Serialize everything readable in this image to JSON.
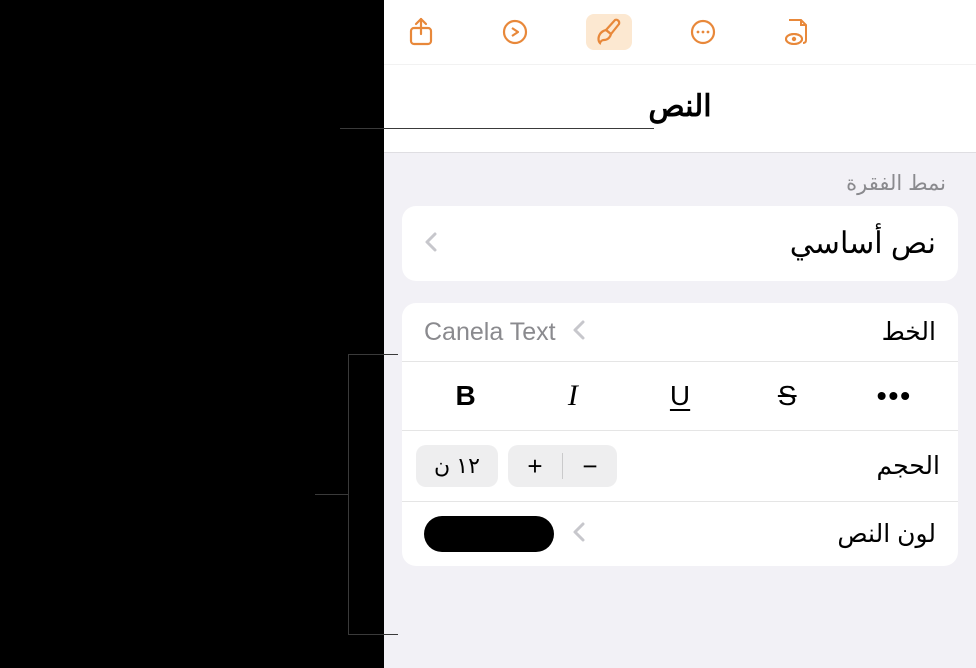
{
  "toolbar": {
    "accent": "#e8883a"
  },
  "panel": {
    "title": "النص",
    "paragraph_style_label": "نمط الفقرة",
    "paragraph_style_value": "نص أساسي",
    "font_label": "الخط",
    "font_value": "Canela Text",
    "styles": {
      "bold": "B",
      "italic": "I",
      "underline": "U",
      "strike": "S",
      "more": "•••"
    },
    "size_label": "الحجم",
    "size_value": "١٢ ن",
    "stepper_minus": "−",
    "stepper_plus": "+",
    "text_color_label": "لون النص",
    "text_color_value": "#000000"
  }
}
